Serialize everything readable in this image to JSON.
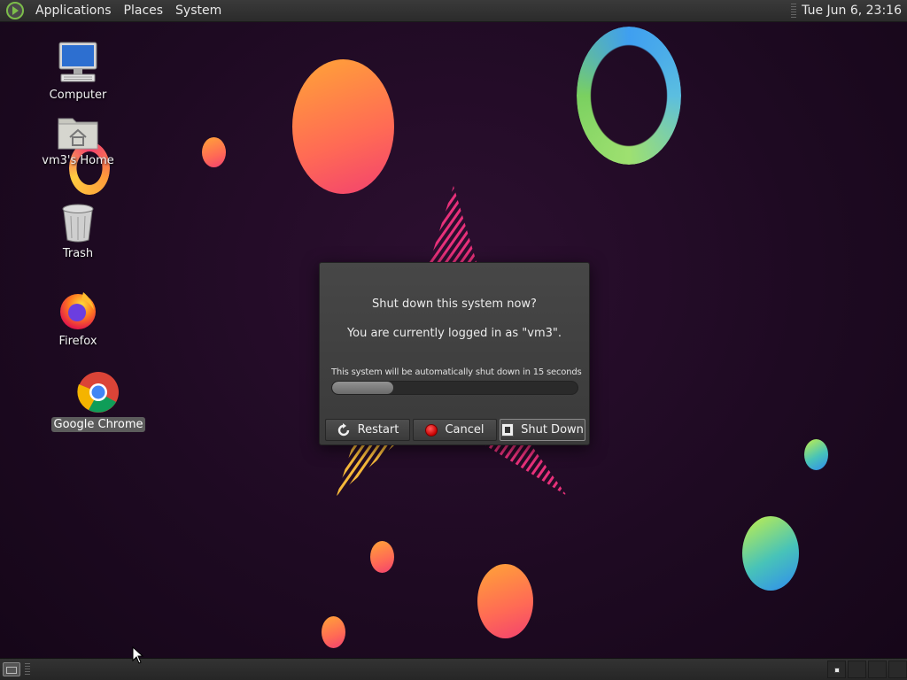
{
  "top_panel": {
    "menus": [
      "Applications",
      "Places",
      "System"
    ],
    "clock": "Tue Jun  6, 23:16"
  },
  "desktop": {
    "icons": [
      {
        "label": "Computer",
        "icon": "computer-icon"
      },
      {
        "label": "vm3's Home",
        "icon": "home-folder-icon"
      },
      {
        "label": "Trash",
        "icon": "trash-icon"
      },
      {
        "label": "Firefox",
        "icon": "firefox-icon"
      },
      {
        "label": "Google Chrome",
        "icon": "chrome-icon",
        "selected": true
      }
    ]
  },
  "dialog": {
    "title": "Shut down this system now?",
    "subtitle": "You are currently logged in as \"vm3\".",
    "countdown": "This system will be automatically shut down in 15 seconds",
    "progress": 0.25,
    "buttons": {
      "restart": "Restart",
      "cancel": "Cancel",
      "shutdown": "Shut Down"
    }
  },
  "bottom_panel": {
    "workspaces": 4,
    "active_workspace": 1
  }
}
